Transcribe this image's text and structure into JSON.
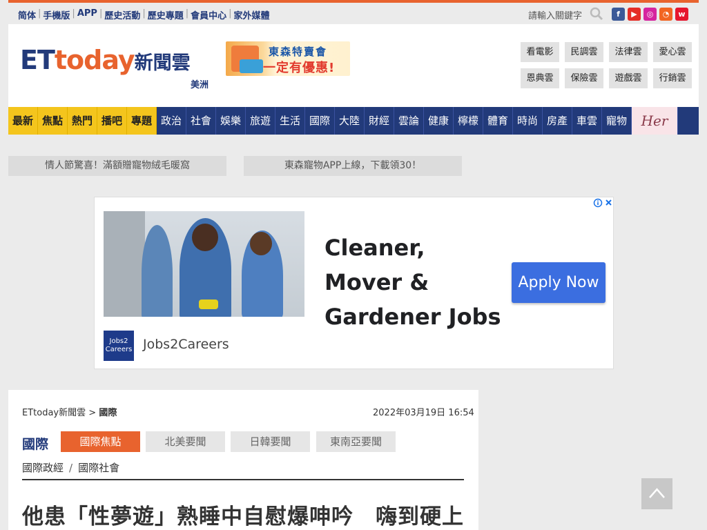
{
  "topbar": {
    "links": [
      "简体",
      "手機版",
      "APP",
      "歷史活動",
      "歷史專題",
      "會員中心",
      "家外媒體"
    ],
    "search_placeholder": "請輸入關鍵字",
    "social": [
      {
        "name": "facebook-icon",
        "glyph": "f",
        "color": "#3b5998"
      },
      {
        "name": "youtube-icon",
        "glyph": "▶",
        "color": "#e52d27"
      },
      {
        "name": "instagram-icon",
        "glyph": "◎",
        "color": "#d6249f"
      },
      {
        "name": "rss-icon",
        "glyph": "◔",
        "color": "#f26522"
      },
      {
        "name": "weibo-icon",
        "glyph": "w",
        "color": "#e6162d"
      }
    ]
  },
  "header": {
    "logo_prefix": "ET",
    "logo_mid": "today",
    "logo_cn": "新聞雲",
    "region": "美洲",
    "promo_line1": "東森特賣會",
    "promo_line2": "一定有優惠!",
    "clouds": [
      "看電影",
      "民調雲",
      "法律雲",
      "愛心雲",
      "恩典雲",
      "保險雲",
      "遊戲雲",
      "行銷雲"
    ]
  },
  "nav": {
    "hot": [
      "最新",
      "焦點",
      "熱門",
      "播吧",
      "專題"
    ],
    "items": [
      "政治",
      "社會",
      "娛樂",
      "旅遊",
      "生活",
      "國際",
      "大陸",
      "財經",
      "雲論",
      "健康",
      "檸檬",
      "體育",
      "時尚",
      "房產",
      "車雲",
      "寵物"
    ],
    "her": "Her"
  },
  "subpromos": [
    "情人節驚喜！滿額贈寵物絨毛暖窩",
    "東森寵物APP上線，下載領30！"
  ],
  "ad": {
    "headline": "Cleaner, Mover & Gardener Jobs",
    "cta": "Apply Now",
    "logo_text": "Jobs2 Careers",
    "brand": "Jobs2Careers"
  },
  "article": {
    "breadcrumb_home": "ETtoday新聞雲",
    "breadcrumb_sep": ">",
    "breadcrumb_section": "國際",
    "date": "2022年03月19日 16:54",
    "section": "國際",
    "tabs": [
      "國際焦點",
      "北美要聞",
      "日韓要聞",
      "東南亞要聞"
    ],
    "subcats": [
      "國際政經",
      "國際社會"
    ],
    "headline": "他患「性夢遊」熟睡中自慰爆呻吟　嗨到硬上"
  },
  "colors": {
    "brand_blue": "#223a7a",
    "brand_orange": "#e8632e",
    "nav_hot": "#f4c51d"
  }
}
